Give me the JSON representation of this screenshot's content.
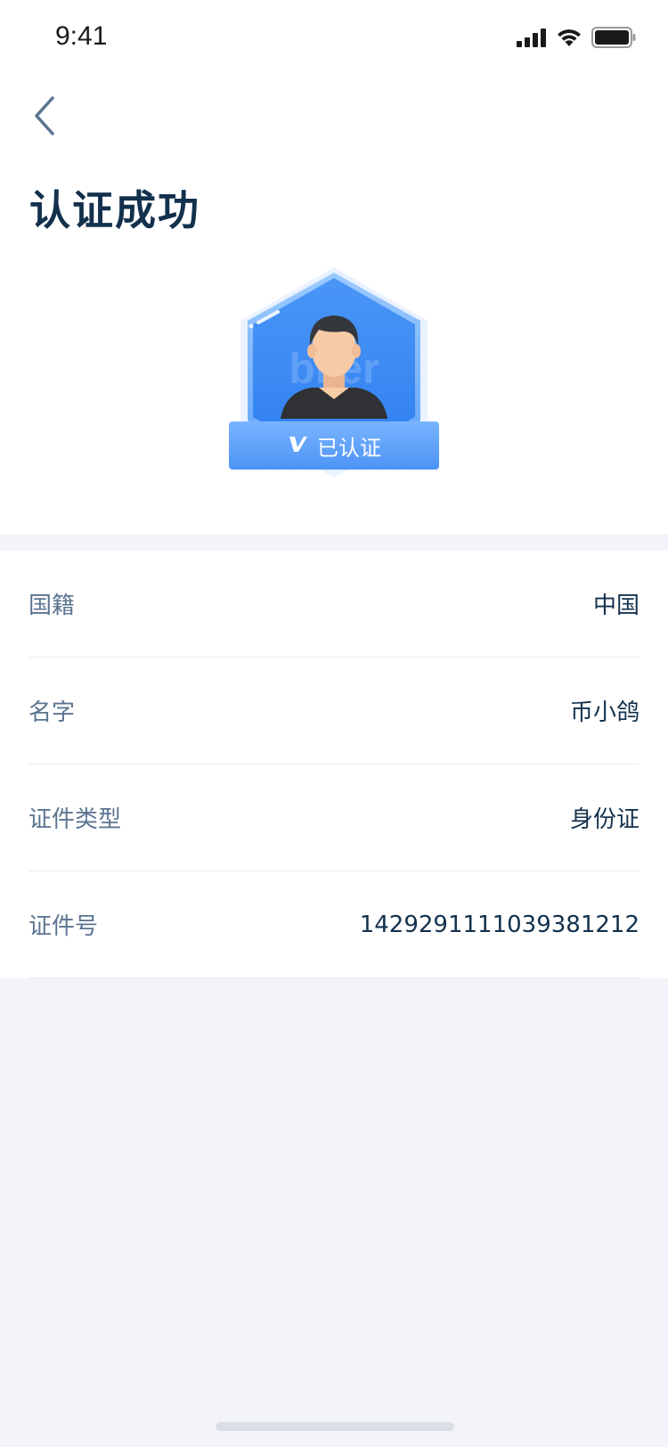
{
  "status_bar": {
    "time": "9:41",
    "icons": [
      "signal-icon",
      "wifi-icon",
      "battery-icon"
    ]
  },
  "header": {
    "back_icon": "chevron-left-icon",
    "title": "认证成功"
  },
  "badge": {
    "label": "已认证",
    "icon": "verified-v-icon",
    "colors": {
      "primary": "#3d8bf5",
      "light": "#8ec1ff"
    }
  },
  "details": {
    "rows": [
      {
        "label": "国籍",
        "value": "中国"
      },
      {
        "label": "名字",
        "value": "币小鸽"
      },
      {
        "label": "证件类型",
        "value": "身份证"
      },
      {
        "label": "证件号",
        "value": "142929111103938121​2"
      }
    ]
  },
  "colors": {
    "title": "#13314d",
    "label": "#5b7490",
    "background": "#f3f4fa",
    "accent": "#3d8bf5"
  }
}
